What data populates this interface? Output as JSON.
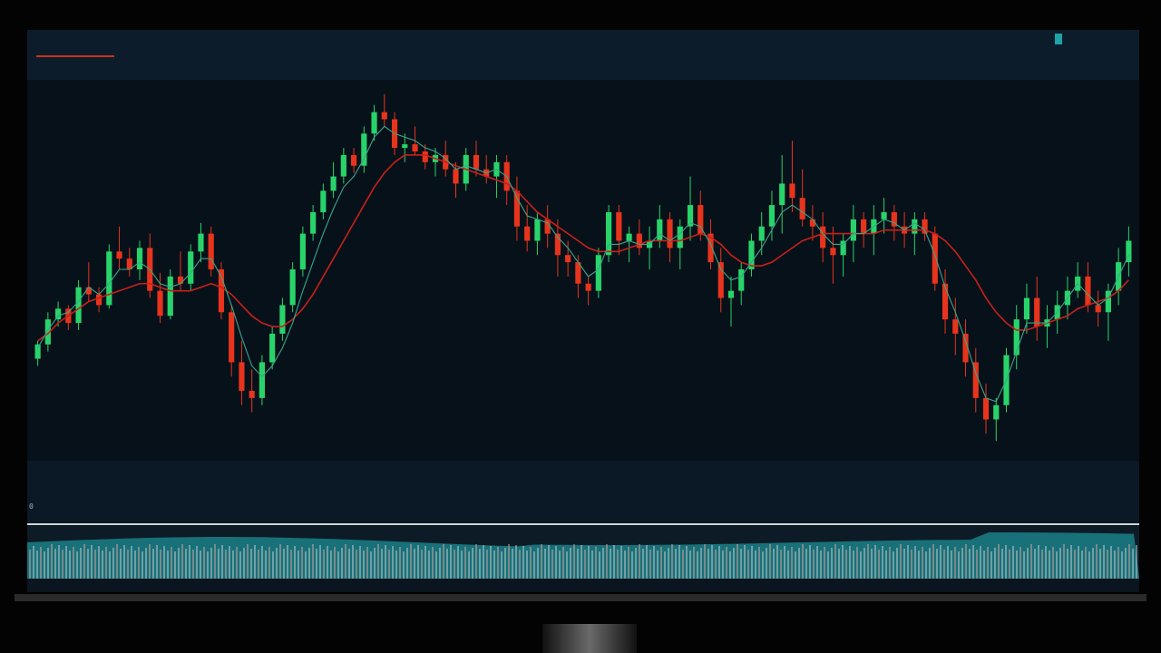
{
  "header": {
    "ticker_line_1": "",
    "ticker_line_2": ""
  },
  "info_panel": {
    "rows": [
      {
        "label": "",
        "value": "",
        "extra": ""
      },
      {
        "label": "",
        "value": "",
        "extra": ""
      },
      {
        "label": "",
        "value": "",
        "extra": ""
      },
      {
        "label": "",
        "value": "",
        "extra": ""
      }
    ]
  },
  "oscillator": {
    "zero_label": "0"
  },
  "bottombar": {
    "left_text": "",
    "right_text": ""
  },
  "colors": {
    "up": "#28d46a",
    "down": "#e8341c",
    "ma_slow": "#c8201a",
    "ma_fast": "#3aa68a",
    "volume_band": "#1c8f94",
    "background": "#07111a"
  },
  "chart_data": {
    "type": "candlestick",
    "title": "",
    "xlabel": "",
    "ylabel": "",
    "ylim": [
      0,
      100
    ],
    "grid": false,
    "series": [
      {
        "type": "ohlc",
        "values": [
          [
            25,
            30,
            23,
            29
          ],
          [
            29,
            38,
            27,
            36
          ],
          [
            36,
            41,
            34,
            39
          ],
          [
            39,
            40,
            33,
            35
          ],
          [
            35,
            47,
            33,
            45
          ],
          [
            45,
            52,
            41,
            43
          ],
          [
            43,
            45,
            38,
            40
          ],
          [
            40,
            57,
            39,
            55
          ],
          [
            55,
            62,
            50,
            53
          ],
          [
            53,
            56,
            48,
            50
          ],
          [
            50,
            58,
            47,
            56
          ],
          [
            56,
            60,
            42,
            44
          ],
          [
            44,
            49,
            35,
            37
          ],
          [
            37,
            50,
            36,
            48
          ],
          [
            48,
            55,
            44,
            46
          ],
          [
            46,
            57,
            44,
            55
          ],
          [
            55,
            63,
            52,
            60
          ],
          [
            60,
            62,
            48,
            50
          ],
          [
            50,
            52,
            36,
            38
          ],
          [
            38,
            40,
            20,
            24
          ],
          [
            24,
            30,
            12,
            16
          ],
          [
            16,
            22,
            10,
            14
          ],
          [
            14,
            26,
            12,
            24
          ],
          [
            24,
            34,
            22,
            32
          ],
          [
            32,
            42,
            30,
            40
          ],
          [
            40,
            52,
            38,
            50
          ],
          [
            50,
            62,
            48,
            60
          ],
          [
            60,
            68,
            58,
            66
          ],
          [
            66,
            74,
            64,
            72
          ],
          [
            72,
            80,
            70,
            76
          ],
          [
            76,
            84,
            74,
            82
          ],
          [
            82,
            84,
            77,
            79
          ],
          [
            79,
            90,
            77,
            88
          ],
          [
            88,
            96,
            86,
            94
          ],
          [
            94,
            99,
            90,
            92
          ],
          [
            92,
            94,
            82,
            84
          ],
          [
            84,
            88,
            80,
            85
          ],
          [
            85,
            90,
            82,
            83
          ],
          [
            83,
            85,
            78,
            80
          ],
          [
            80,
            84,
            76,
            82
          ],
          [
            82,
            86,
            76,
            78
          ],
          [
            78,
            80,
            70,
            74
          ],
          [
            74,
            84,
            72,
            82
          ],
          [
            82,
            86,
            76,
            78
          ],
          [
            78,
            82,
            74,
            76
          ],
          [
            76,
            82,
            70,
            80
          ],
          [
            80,
            82,
            68,
            72
          ],
          [
            72,
            76,
            58,
            62
          ],
          [
            62,
            68,
            55,
            58
          ],
          [
            58,
            66,
            54,
            64
          ],
          [
            64,
            68,
            56,
            60
          ],
          [
            60,
            64,
            48,
            54
          ],
          [
            54,
            58,
            48,
            52
          ],
          [
            52,
            54,
            42,
            46
          ],
          [
            46,
            48,
            40,
            44
          ],
          [
            44,
            56,
            42,
            54
          ],
          [
            54,
            68,
            52,
            66
          ],
          [
            66,
            68,
            54,
            58
          ],
          [
            58,
            62,
            52,
            60
          ],
          [
            60,
            64,
            54,
            56
          ],
          [
            56,
            62,
            50,
            58
          ],
          [
            58,
            68,
            56,
            64
          ],
          [
            64,
            66,
            52,
            56
          ],
          [
            56,
            64,
            50,
            62
          ],
          [
            62,
            76,
            58,
            68
          ],
          [
            68,
            72,
            58,
            60
          ],
          [
            60,
            64,
            50,
            52
          ],
          [
            52,
            56,
            38,
            42
          ],
          [
            42,
            48,
            34,
            44
          ],
          [
            44,
            52,
            40,
            50
          ],
          [
            50,
            60,
            48,
            58
          ],
          [
            58,
            66,
            54,
            62
          ],
          [
            62,
            72,
            58,
            68
          ],
          [
            68,
            82,
            60,
            74
          ],
          [
            74,
            86,
            66,
            70
          ],
          [
            70,
            78,
            62,
            64
          ],
          [
            64,
            68,
            58,
            62
          ],
          [
            62,
            66,
            52,
            56
          ],
          [
            56,
            62,
            46,
            54
          ],
          [
            54,
            60,
            48,
            58
          ],
          [
            58,
            68,
            52,
            64
          ],
          [
            64,
            66,
            56,
            60
          ],
          [
            60,
            68,
            54,
            64
          ],
          [
            64,
            70,
            60,
            66
          ],
          [
            66,
            68,
            58,
            62
          ],
          [
            62,
            66,
            56,
            60
          ],
          [
            60,
            66,
            54,
            64
          ],
          [
            64,
            66,
            58,
            60
          ],
          [
            60,
            62,
            44,
            46
          ],
          [
            46,
            50,
            32,
            36
          ],
          [
            36,
            42,
            26,
            32
          ],
          [
            32,
            36,
            20,
            24
          ],
          [
            24,
            28,
            10,
            14
          ],
          [
            14,
            18,
            4,
            8
          ],
          [
            8,
            14,
            2,
            12
          ],
          [
            12,
            28,
            10,
            26
          ],
          [
            26,
            40,
            22,
            36
          ],
          [
            36,
            46,
            32,
            42
          ],
          [
            42,
            48,
            30,
            34
          ],
          [
            34,
            40,
            28,
            36
          ],
          [
            36,
            44,
            32,
            40
          ],
          [
            40,
            48,
            36,
            44
          ],
          [
            44,
            52,
            42,
            48
          ],
          [
            48,
            52,
            38,
            40
          ],
          [
            40,
            44,
            34,
            38
          ],
          [
            38,
            46,
            30,
            44
          ],
          [
            44,
            56,
            40,
            52
          ],
          [
            52,
            62,
            48,
            58
          ]
        ]
      },
      {
        "name": "",
        "type": "line",
        "values": [
          30,
          32,
          35,
          37,
          39,
          41,
          42,
          43,
          44,
          45,
          46,
          46,
          45,
          44,
          44,
          44,
          45,
          46,
          45,
          43,
          40,
          37,
          35,
          34,
          34,
          36,
          39,
          43,
          48,
          53,
          58,
          63,
          68,
          73,
          77,
          80,
          82,
          82,
          82,
          81,
          80,
          79,
          78,
          77,
          76,
          75,
          74,
          72,
          69,
          66,
          64,
          62,
          60,
          58,
          56,
          55,
          55,
          55,
          56,
          57,
          58,
          58,
          58,
          58,
          59,
          60,
          59,
          57,
          54,
          52,
          51,
          51,
          52,
          54,
          56,
          58,
          59,
          60,
          60,
          60,
          60,
          60,
          60,
          61,
          61,
          61,
          61,
          61,
          60,
          58,
          55,
          51,
          47,
          42,
          38,
          35,
          33,
          33,
          34,
          35,
          36,
          37,
          39,
          40,
          41,
          42,
          44,
          47
        ]
      },
      {
        "name": "",
        "type": "line",
        "values": [
          28,
          33,
          37,
          38,
          41,
          45,
          43,
          46,
          50,
          50,
          52,
          50,
          46,
          45,
          46,
          49,
          53,
          53,
          48,
          40,
          31,
          23,
          20,
          23,
          28,
          35,
          44,
          52,
          60,
          67,
          73,
          76,
          81,
          87,
          90,
          88,
          87,
          86,
          84,
          83,
          81,
          78,
          79,
          78,
          77,
          78,
          76,
          70,
          65,
          64,
          63,
          59,
          56,
          52,
          48,
          50,
          57,
          57,
          58,
          57,
          57,
          60,
          58,
          60,
          63,
          62,
          57,
          50,
          47,
          48,
          52,
          56,
          61,
          66,
          68,
          66,
          64,
          60,
          57,
          57,
          60,
          60,
          62,
          64,
          63,
          61,
          63,
          61,
          54,
          45,
          38,
          30,
          21,
          14,
          13,
          19,
          27,
          35,
          35,
          35,
          38,
          42,
          46,
          43,
          40,
          42,
          48,
          54
        ]
      }
    ]
  }
}
